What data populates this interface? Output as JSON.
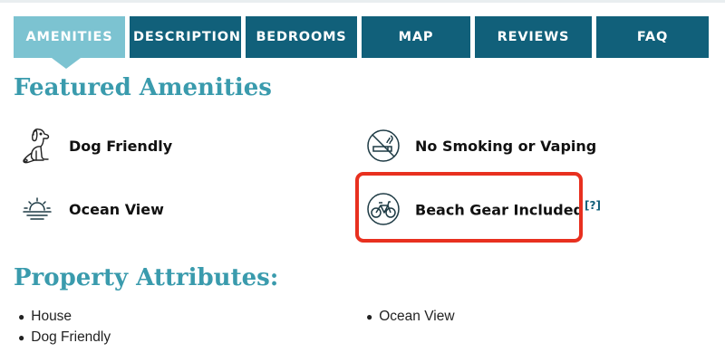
{
  "tabs": [
    {
      "label": "AMENITIES",
      "active": true
    },
    {
      "label": "DESCRIPTION",
      "active": false
    },
    {
      "label": "BEDROOMS",
      "active": false
    },
    {
      "label": "MAP",
      "active": false
    },
    {
      "label": "REVIEWS",
      "active": false
    },
    {
      "label": "FAQ",
      "active": false
    }
  ],
  "featured": {
    "title": "Featured Amenities",
    "items": [
      {
        "label": "Dog Friendly",
        "icon": "dog-icon"
      },
      {
        "label": "No Smoking or Vaping",
        "icon": "no-smoking-icon"
      },
      {
        "label": "Ocean View",
        "icon": "sunset-icon"
      },
      {
        "label": "Beach Gear Included",
        "icon": "bicycle-icon",
        "help": "[?]",
        "highlighted": true
      }
    ]
  },
  "attributes": {
    "title": "Property Attributes:",
    "items": [
      "House",
      "Dog Friendly",
      "Ocean View"
    ]
  },
  "colors": {
    "tab_dark": "#11607a",
    "tab_active": "#7cc3d1",
    "heading": "#3a9bad",
    "highlight": "#e8301f"
  }
}
